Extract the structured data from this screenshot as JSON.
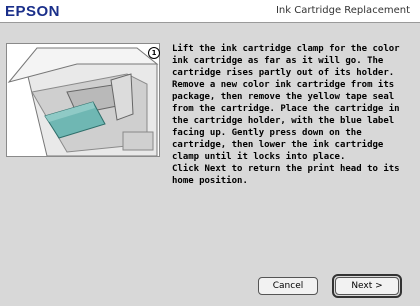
{
  "header": {
    "brand": "EPSON",
    "title": "Ink Cartridge Replacement"
  },
  "illustration": {
    "step_number": "1"
  },
  "instructions": [
    "Lift the ink cartridge clamp for the color ink cartridge as far as it will go. The cartridge rises partly out of its holder.",
    "Remove a new color ink cartridge from its package, then remove the yellow tape seal from the cartridge. Place the cartridge in the cartridge holder, with the blue label facing up. Gently press down on the cartridge, then lower the ink cartridge clamp until it locks into place.",
    "Click Next to return the print head to its home position."
  ],
  "buttons": {
    "cancel": "Cancel",
    "next": "Next >"
  }
}
